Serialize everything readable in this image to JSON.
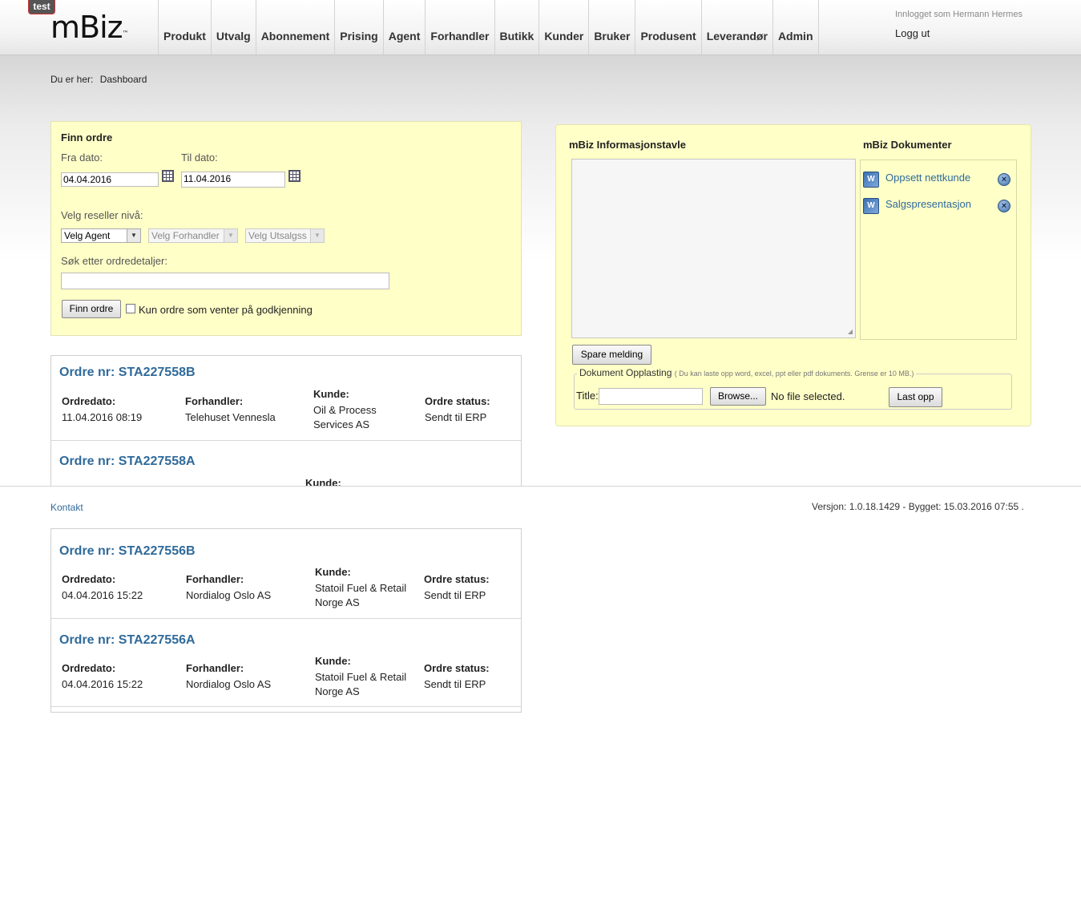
{
  "env_badge": "test",
  "logo": {
    "text": "mBiz",
    "tm": "™"
  },
  "nav": [
    "Produkt",
    "Utvalg",
    "Abonnement",
    "Prising",
    "Agent",
    "Forhandler",
    "Butikk",
    "Kunder",
    "Bruker",
    "Produsent",
    "Leverandør",
    "Admin"
  ],
  "user": {
    "logged_in": "Innlogget som Hermann Hermes",
    "logout": "Logg ut"
  },
  "breadcrumb": {
    "label": "Du er her:",
    "current": "Dashboard"
  },
  "finn_ordre": {
    "title": "Finn ordre",
    "fra_label": "Fra dato:",
    "fra_value": "04.04.2016",
    "til_label": "Til dato:",
    "til_value": "11.04.2016",
    "reseller_label": "Velg reseller nivå:",
    "agent_select": "Velg Agent",
    "forhandler_select": "Velg Forhandler",
    "utsalgs_select": "Velg Utsalgss",
    "search_label": "Søk etter ordredetaljer:",
    "search_value": "",
    "button": "Finn ordre",
    "checkbox_label": "Kun ordre som venter på godkjenning"
  },
  "order_labels": {
    "date": "Ordredato:",
    "dealer": "Forhandler:",
    "customer": "Kunde:",
    "status": "Ordre status:"
  },
  "orders": [
    {
      "title": "Ordre nr: STA227558B",
      "date": "11.04.2016 08:19",
      "dealer": "Telehuset Vennesla",
      "customer": "Oil & Process Services AS",
      "status": "Sendt til ERP"
    },
    {
      "title": "Ordre nr: STA227558A",
      "date": "",
      "dealer": "",
      "customer": "",
      "status": ""
    },
    {
      "title": "Ordre nr: STA227556B",
      "date": "04.04.2016 15:22",
      "dealer": "Nordialog Oslo AS",
      "customer": "Statoil Fuel & Retail Norge AS",
      "status": "Sendt til ERP"
    },
    {
      "title": "Ordre nr: STA227556A",
      "date": "04.04.2016 15:22",
      "dealer": "Nordialog Oslo AS",
      "customer": "Statoil Fuel & Retail Norge AS",
      "status": "Sendt til ERP"
    }
  ],
  "info_board": {
    "title": "mBiz Informasjonstavle",
    "docs_title": "mBiz Dokumenter",
    "docs": [
      "Oppsett nettkunde",
      "Salgspresentasjon"
    ],
    "save_button": "Spare melding",
    "upload_legend": "Dokument Opplasting",
    "upload_hint": "( Du kan laste opp word, excel, ppt eller pdf dokuments. Grense er 10 MB.)",
    "title_label": "Title:",
    "browse_button": "Browse...",
    "no_file": "No file selected.",
    "upload_button": "Last opp"
  },
  "footer": {
    "contact": "Kontakt",
    "version": "Versjon: 1.0.18.1429 - Bygget: 15.03.2016 07:55  ."
  }
}
